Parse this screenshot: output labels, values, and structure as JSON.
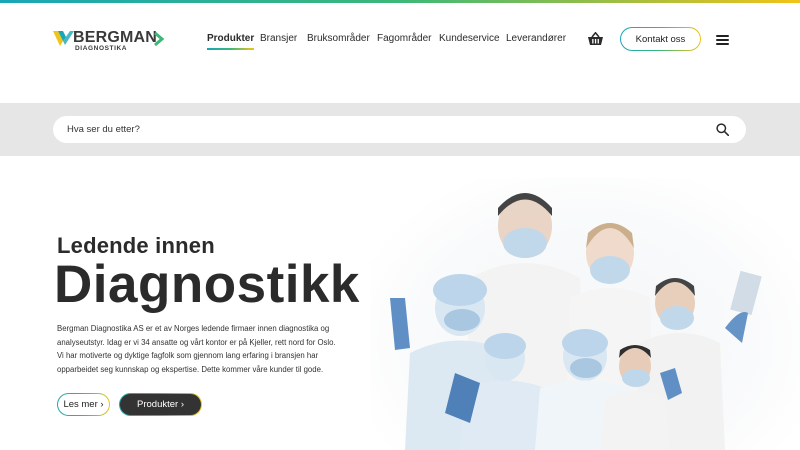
{
  "brand": {
    "name": "BERGMAN",
    "subtitle": "DIAGNOSTIKA",
    "colors": {
      "teal": "#1aa6b7",
      "green": "#3cb878",
      "yellow": "#f2c318",
      "dark": "#2b2b2b"
    }
  },
  "nav": {
    "items": [
      {
        "label": "Produkter",
        "active": true
      },
      {
        "label": "Bransjer"
      },
      {
        "label": "Bruksområder"
      },
      {
        "label": "Fagområder"
      },
      {
        "label": "Kundeservice"
      },
      {
        "label": "Leverandører"
      }
    ],
    "cart_icon": "basket-icon",
    "contact_label": "Kontakt oss",
    "menu_icon": "hamburger-menu-icon"
  },
  "search": {
    "placeholder": "Hva ser du etter?",
    "value": "",
    "icon": "search-icon"
  },
  "hero": {
    "kicker": "Ledende innen",
    "headline": "Diagnostikk",
    "intro_lines": [
      "Bergman Diagnostika AS er et av Norges ledende firmaer innen diagnostika og",
      "analyseutstyr. Idag er vi 34 ansatte og vårt kontor er på Kjeller, rett nord for Oslo.",
      "Vi har motiverte og dyktige fagfolk som gjennom lang erfaring i bransjen har",
      "opparbeidet seg kunnskap og ekspertise. Dette kommer våre kunder til gode."
    ],
    "primary_button": "Les mer ›",
    "secondary_button": "Produkter ›",
    "image_subject": "medical-team-in-masks-illustration"
  }
}
